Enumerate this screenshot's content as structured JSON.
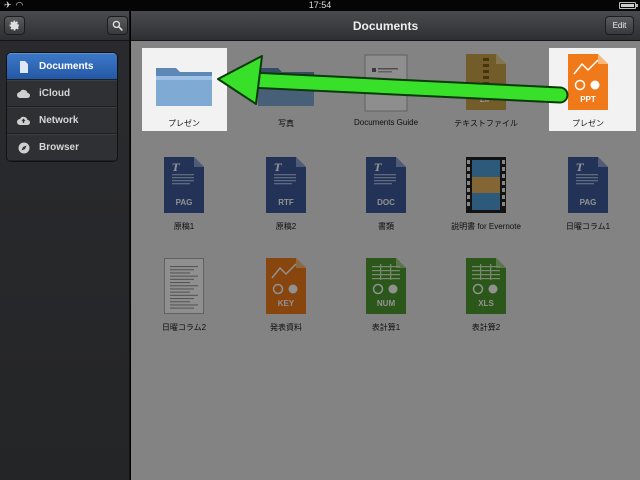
{
  "status": {
    "time": "17:54"
  },
  "sidebar": {
    "items": [
      {
        "label": "Documents",
        "icon": "document-icon",
        "active": true
      },
      {
        "label": "iCloud",
        "icon": "cloud-icon",
        "active": false
      },
      {
        "label": "Network",
        "icon": "network-cloud-icon",
        "active": false
      },
      {
        "label": "Browser",
        "icon": "compass-icon",
        "active": false
      }
    ]
  },
  "header": {
    "title": "Documents",
    "edit_label": "Edit"
  },
  "files": [
    {
      "name": "プレゼン",
      "kind": "folder",
      "badge": ""
    },
    {
      "name": "写真",
      "kind": "folder",
      "badge": ""
    },
    {
      "name": "Documents Guide",
      "kind": "pdf",
      "badge": ""
    },
    {
      "name": "テキストファイル",
      "kind": "zip",
      "badge": "ZIP"
    },
    {
      "name": "プレゼン",
      "kind": "ppt",
      "badge": "PPT"
    },
    {
      "name": "原稿1",
      "kind": "doc",
      "badge": "PAG"
    },
    {
      "name": "原稿2",
      "kind": "doc",
      "badge": "RTF"
    },
    {
      "name": "書類",
      "kind": "doc",
      "badge": "DOC"
    },
    {
      "name": "説明書 for Evernote",
      "kind": "video",
      "badge": ""
    },
    {
      "name": "日曜コラム1",
      "kind": "doc",
      "badge": "PAG"
    },
    {
      "name": "日曜コラム2",
      "kind": "paper",
      "badge": ""
    },
    {
      "name": "発表資料",
      "kind": "key",
      "badge": "KEY"
    },
    {
      "name": "表計算1",
      "kind": "sheet",
      "badge": "NUM"
    },
    {
      "name": "表計算2",
      "kind": "sheet",
      "badge": "XLS"
    }
  ],
  "colors": {
    "accent_arrow": "#38e02a",
    "active_nav": "#2e63b0",
    "word_blue": "#3f5a9c",
    "ppt_orange": "#f07a1a",
    "sheet_green": "#4e9a2e"
  }
}
